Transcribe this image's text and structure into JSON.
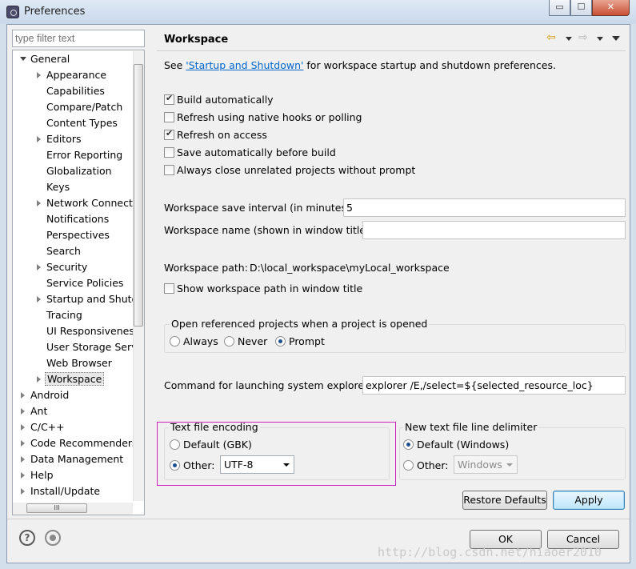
{
  "window": {
    "title": "Preferences",
    "min_glyph": "▭",
    "max_glyph": "☐",
    "close_glyph": "✕"
  },
  "filter": {
    "placeholder": "type filter text"
  },
  "tree": {
    "general": "General",
    "children": [
      "Appearance",
      "Capabilities",
      "Compare/Patch",
      "Content Types",
      "Editors",
      "Error Reporting",
      "Globalization",
      "Keys",
      "Network Connecti",
      "Notifications",
      "Perspectives",
      "Search",
      "Security",
      "Service Policies",
      "Startup and Shutd",
      "Tracing",
      "UI Responsivenes",
      "User Storage Serv",
      "Web Browser",
      "Workspace"
    ],
    "roots": [
      "Android",
      "Ant",
      "C/C++",
      "Code Recommenders",
      "Data Management",
      "Help",
      "Install/Update"
    ],
    "hscroll_grip": "III"
  },
  "panel": {
    "title": "Workspace",
    "see_prefix": "See ",
    "see_link": "'Startup and Shutdown'",
    "see_suffix": " for workspace startup and shutdown preferences.",
    "options": {
      "build_auto": "Build automatically",
      "refresh_native": "Refresh using native hooks or polling",
      "refresh_access": "Refresh on access",
      "save_before_build": "Save automatically before build",
      "close_unrelated": "Always close unrelated projects without prompt"
    },
    "save_interval_label": "Workspace save interval (in minutes):",
    "save_interval_value": "5",
    "ws_name_label": "Workspace name (shown in window title):",
    "ws_name_value": "",
    "ws_path_label": "Workspace path:",
    "ws_path_value": "D:\\local_workspace\\myLocal_workspace",
    "show_path": "Show workspace path in window title",
    "open_ref_group": "Open referenced projects when a project is opened",
    "open_ref": {
      "always": "Always",
      "never": "Never",
      "prompt": "Prompt"
    },
    "explorer_label": "Command for launching system explorer:",
    "explorer_value": "explorer /E,/select=${selected_resource_loc}",
    "encoding_group": "Text file encoding",
    "encoding_default": "Default (GBK)",
    "encoding_other": "Other:",
    "encoding_value": "UTF-8",
    "delim_group": "New text file line delimiter",
    "delim_default": "Default (Windows)",
    "delim_other": "Other:",
    "delim_value": "Windows",
    "restore": "Restore Defaults",
    "apply": "Apply"
  },
  "footer": {
    "help_glyph": "?",
    "ok": "OK",
    "cancel": "Cancel"
  },
  "watermark": "http://blog.csdn.net/hiaoer2010"
}
